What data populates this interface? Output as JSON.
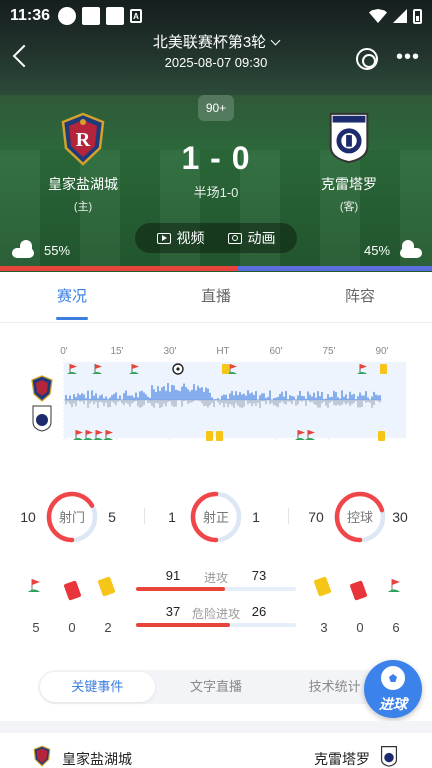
{
  "status_bar": {
    "time": "11:36"
  },
  "header": {
    "title": "北美联赛杯第3轮",
    "datetime": "2025-08-07 09:30",
    "minute_badge": "90+"
  },
  "match": {
    "home": {
      "name": "皇家盐湖城",
      "side": "(主)",
      "possession": "55%",
      "possession_value": 55,
      "color": "#e8443b"
    },
    "away": {
      "name": "克雷塔罗",
      "side": "(客)",
      "possession": "45%",
      "possession_value": 45,
      "color": "#5c6de0"
    },
    "score": "1 - 0",
    "halftime": "半场1-0"
  },
  "media": {
    "video": "视频",
    "animation": "动画"
  },
  "tabs": [
    "赛况",
    "直播",
    "阵容"
  ],
  "timeline": {
    "ticks": [
      "0'",
      "15'",
      "30'",
      "HT",
      "60'",
      "75'",
      "90'"
    ],
    "icons": [
      "home-crest-icon",
      "away-crest-icon",
      "corner-flag-icon",
      "yellow-card-icon",
      "goal-ball-icon"
    ]
  },
  "circle_stats": [
    {
      "label": "射门",
      "home": "10",
      "away": "5",
      "home_value": 10,
      "away_value": 5
    },
    {
      "label": "射正",
      "home": "1",
      "away": "1",
      "home_value": 1,
      "away_value": 1
    },
    {
      "label": "控球",
      "home": "70",
      "away": "30",
      "home_value": 70,
      "away_value": 30
    }
  ],
  "bar_stats": [
    {
      "label": "进攻",
      "home": "91",
      "away": "73",
      "home_value": 91,
      "away_value": 73
    },
    {
      "label": "危险进攻",
      "home": "37",
      "away": "26",
      "home_value": 37,
      "away_value": 26
    }
  ],
  "side_counts": {
    "home": {
      "corners": "5",
      "red": "0",
      "yellow": "2"
    },
    "away": {
      "yellow": "3",
      "red": "0",
      "corners": "6"
    }
  },
  "sub_tabs": [
    "关键事件",
    "文字直播",
    "技术统计"
  ],
  "fab": {
    "label": "进球"
  },
  "colors": {
    "accent": "#3b7ee0",
    "home": "#e8443b",
    "away": "#5c6de0",
    "ring_home": "#f0464a",
    "ring_away": "#dce6f5",
    "yellow": "#f5c518",
    "red": "#e8343b"
  }
}
